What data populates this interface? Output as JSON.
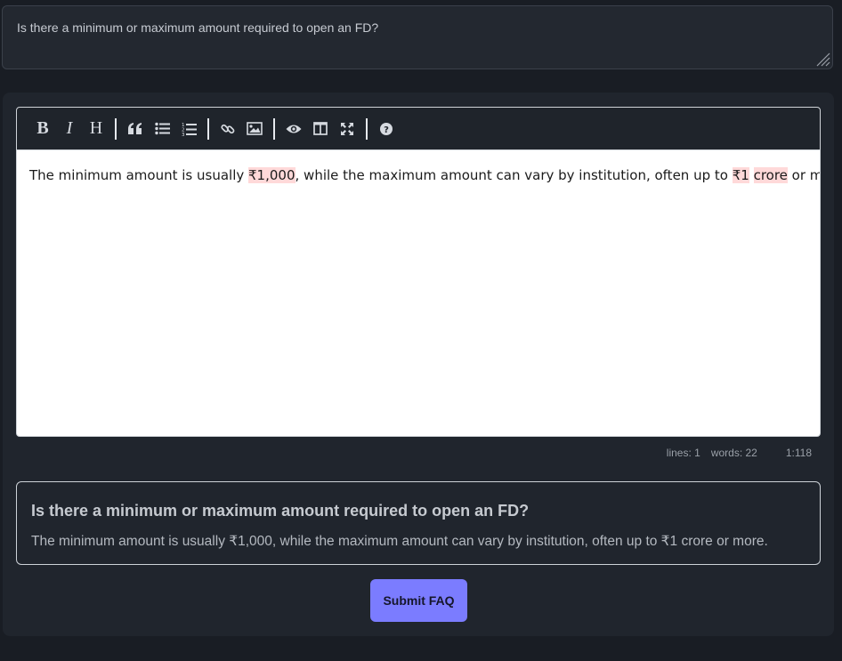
{
  "question_field": {
    "value": "Is there a minimum or maximum amount required to open an FD?"
  },
  "editor": {
    "toolbar": [
      {
        "name": "bold",
        "label": "B",
        "icon": "bold-icon"
      },
      {
        "name": "italic",
        "label": "I",
        "icon": "italic-icon"
      },
      {
        "name": "heading",
        "label": "H",
        "icon": "heading-icon"
      },
      {
        "name": "quote",
        "icon": "quote-icon"
      },
      {
        "name": "unordered-list",
        "icon": "unordered-list-icon"
      },
      {
        "name": "ordered-list",
        "icon": "ordered-list-icon"
      },
      {
        "name": "link",
        "icon": "link-icon"
      },
      {
        "name": "image",
        "icon": "image-icon"
      },
      {
        "name": "preview",
        "icon": "eye-icon"
      },
      {
        "name": "side-by-side",
        "icon": "columns-icon"
      },
      {
        "name": "fullscreen",
        "icon": "fullscreen-icon"
      },
      {
        "name": "guide",
        "icon": "help-icon"
      }
    ],
    "content": {
      "part1": "The minimum amount is usually ",
      "highlight1": "₹1,000",
      "part2": ", while the maximum amount can vary by institution, often up to ",
      "highlight2a": "₹1",
      "space": " ",
      "highlight2b": "crore",
      "part3": " or more."
    },
    "status": {
      "lines": "lines: 1",
      "words": "words: 22",
      "cursor": "1:118"
    },
    "highlight_color": "#ffd9d9"
  },
  "preview": {
    "title": "Is there a minimum or maximum amount required to open an FD?",
    "body": "The minimum amount is usually ₹1,000, while the maximum amount can vary by institution, often up to ₹1 crore or more."
  },
  "submit": {
    "label": "Submit FAQ",
    "color": "#7b7cff"
  }
}
